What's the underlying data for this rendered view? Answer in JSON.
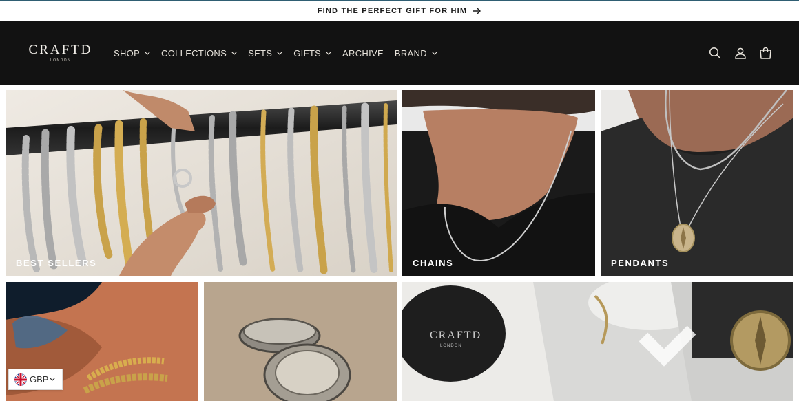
{
  "announcement": {
    "text": "FIND THE PERFECT GIFT FOR HIM"
  },
  "logo": {
    "main": "CRAFTD",
    "sub": "LONDON"
  },
  "nav": [
    {
      "label": "SHOP",
      "dropdown": true
    },
    {
      "label": "COLLECTIONS",
      "dropdown": true
    },
    {
      "label": "SETS",
      "dropdown": true
    },
    {
      "label": "GIFTS",
      "dropdown": true
    },
    {
      "label": "ARCHIVE",
      "dropdown": false
    },
    {
      "label": "BRAND",
      "dropdown": true
    }
  ],
  "header_icons": [
    "search-icon",
    "account-icon",
    "cart-icon"
  ],
  "tiles": {
    "best_sellers": "BEST SELLERS",
    "chains": "CHAINS",
    "pendants": "PENDANTS"
  },
  "currency": {
    "code": "GBP"
  },
  "colors": {
    "header_bg": "#121212",
    "announcement_border": "#2f5e73",
    "gold": "#c9a24a",
    "silver": "#b9b9b9"
  }
}
